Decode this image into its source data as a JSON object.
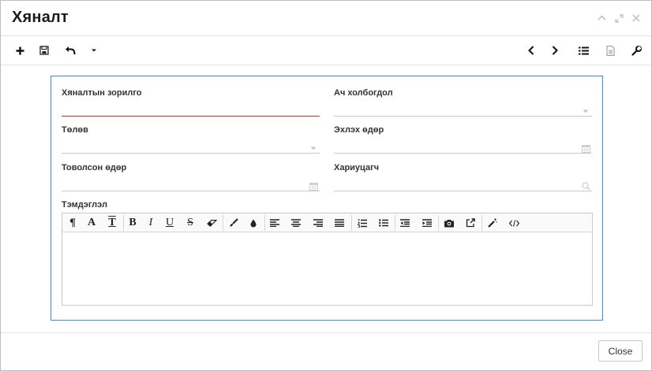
{
  "dialog": {
    "title": "Хяналт",
    "window_controls": [
      "collapse-icon",
      "expand-icon",
      "close-icon"
    ]
  },
  "toolbar": {
    "left_buttons": [
      "plus-icon",
      "save-icon",
      "undo-icon",
      "caret-down-icon"
    ],
    "right_buttons": [
      "chevron-left-icon",
      "chevron-right-icon",
      "list-icon",
      "document-icon",
      "wrench-icon"
    ]
  },
  "form": {
    "goal_label": "Хяналтын зорилго",
    "goal_value": "",
    "reference_label": "Ач холбогдол",
    "reference_value": "",
    "status_label": "Төлөв",
    "status_value": "",
    "start_date_label": "Эхлэх өдөр",
    "start_date_value": "",
    "end_date_label": "Товолсон өдөр",
    "end_date_value": "",
    "responsible_label": "Хариуцагч",
    "responsible_value": "",
    "notes_label": "Тэмдэглэл",
    "notes_value": ""
  },
  "editor_toolbar": {
    "paragraph": "¶",
    "font": "A",
    "clear_format": "T",
    "bold": "B",
    "italic": "I",
    "underline": "U",
    "strike": "S"
  },
  "footer": {
    "close_label": "Close"
  },
  "colors": {
    "panel_border": "#3e8fd6",
    "invalid_underline": "#c0392b"
  }
}
